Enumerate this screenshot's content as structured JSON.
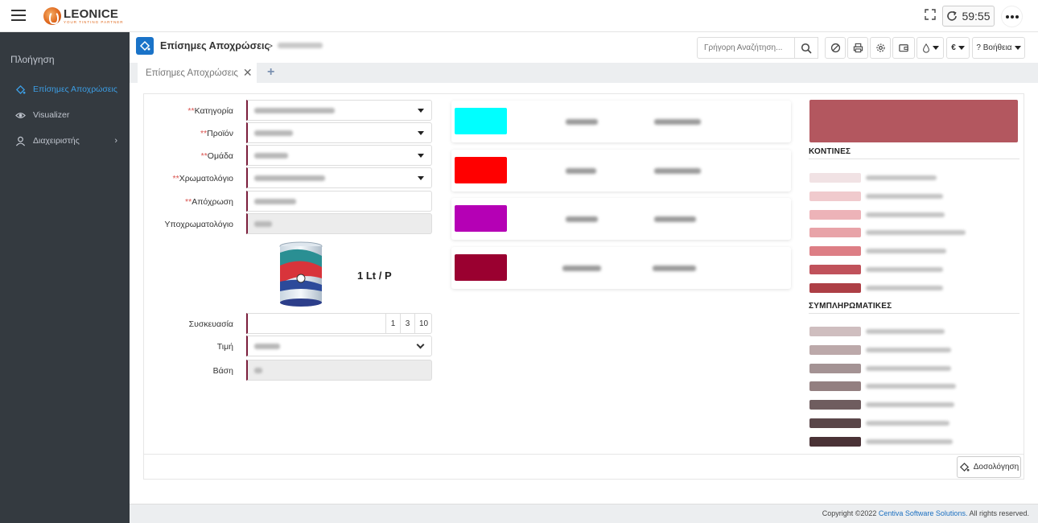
{
  "app": {
    "brand": "LEONICE",
    "brand_tag": "YOUR TINTING PARTNER",
    "timer": "59:55"
  },
  "sidebar": {
    "heading": "Πλοήγηση",
    "items": [
      {
        "label": "Επίσημες Αποχρώσεις",
        "icon": "paint-bucket-icon",
        "active": true
      },
      {
        "label": "Visualizer",
        "icon": "eye-icon",
        "active": false
      },
      {
        "label": "Διαχειριστής",
        "icon": "user-icon",
        "active": false
      }
    ]
  },
  "header": {
    "title": "Επίσημες Αποχρώσεις",
    "breadcrumb_sep": ">",
    "search_placeholder": "Γρήγορη Αναζήτηση...",
    "currency": "€",
    "help_label": "? Βοήθεια"
  },
  "tabs": [
    {
      "label": "Επίσημες Αποχρώσεις"
    }
  ],
  "form": {
    "category_label": "Κατηγορία",
    "product_label": "Προϊόν",
    "group_label": "Ομάδα",
    "colorbook_label": "Χρωματολόγιο",
    "shade_label": "Απόχρωση",
    "subcolorbook_label": "Υποχρωματολόγιο",
    "size_label": "1 Lt / P",
    "packaging_label": "Συσκευασία",
    "packaging_options": [
      "1",
      "3",
      "10"
    ],
    "price_label": "Τιμή",
    "base_label": "Βάση",
    "required_mark": "**"
  },
  "colorants": [
    {
      "color": "#00FFFF"
    },
    {
      "color": "#FF0000"
    },
    {
      "color": "#B500B5"
    },
    {
      "color": "#9A0030"
    }
  ],
  "right_panel": {
    "main_color": "#B3575F",
    "near_title": "ΚΟΝΤΙΝΕΣ",
    "near_colors": [
      "#F1E2E4",
      "#F0CACD",
      "#EDB3B8",
      "#E8A3A8",
      "#DD7E85",
      "#C0525B",
      "#AD3F46"
    ],
    "complementary_title": "ΣΥΜΠΛΗΡΩΜΑΤΙΚΕΣ",
    "complementary_colors": [
      "#CFBEBF",
      "#BCA9AA",
      "#A49394",
      "#937F80",
      "#6F5D5F",
      "#5A4649",
      "#4A3236"
    ]
  },
  "actions": {
    "dosage_label": "Δοσολόγηση"
  },
  "footer": {
    "copyright": "Copyright ©2022",
    "company": "Centiva Software Solutions.",
    "rights": "All rights reserved."
  }
}
